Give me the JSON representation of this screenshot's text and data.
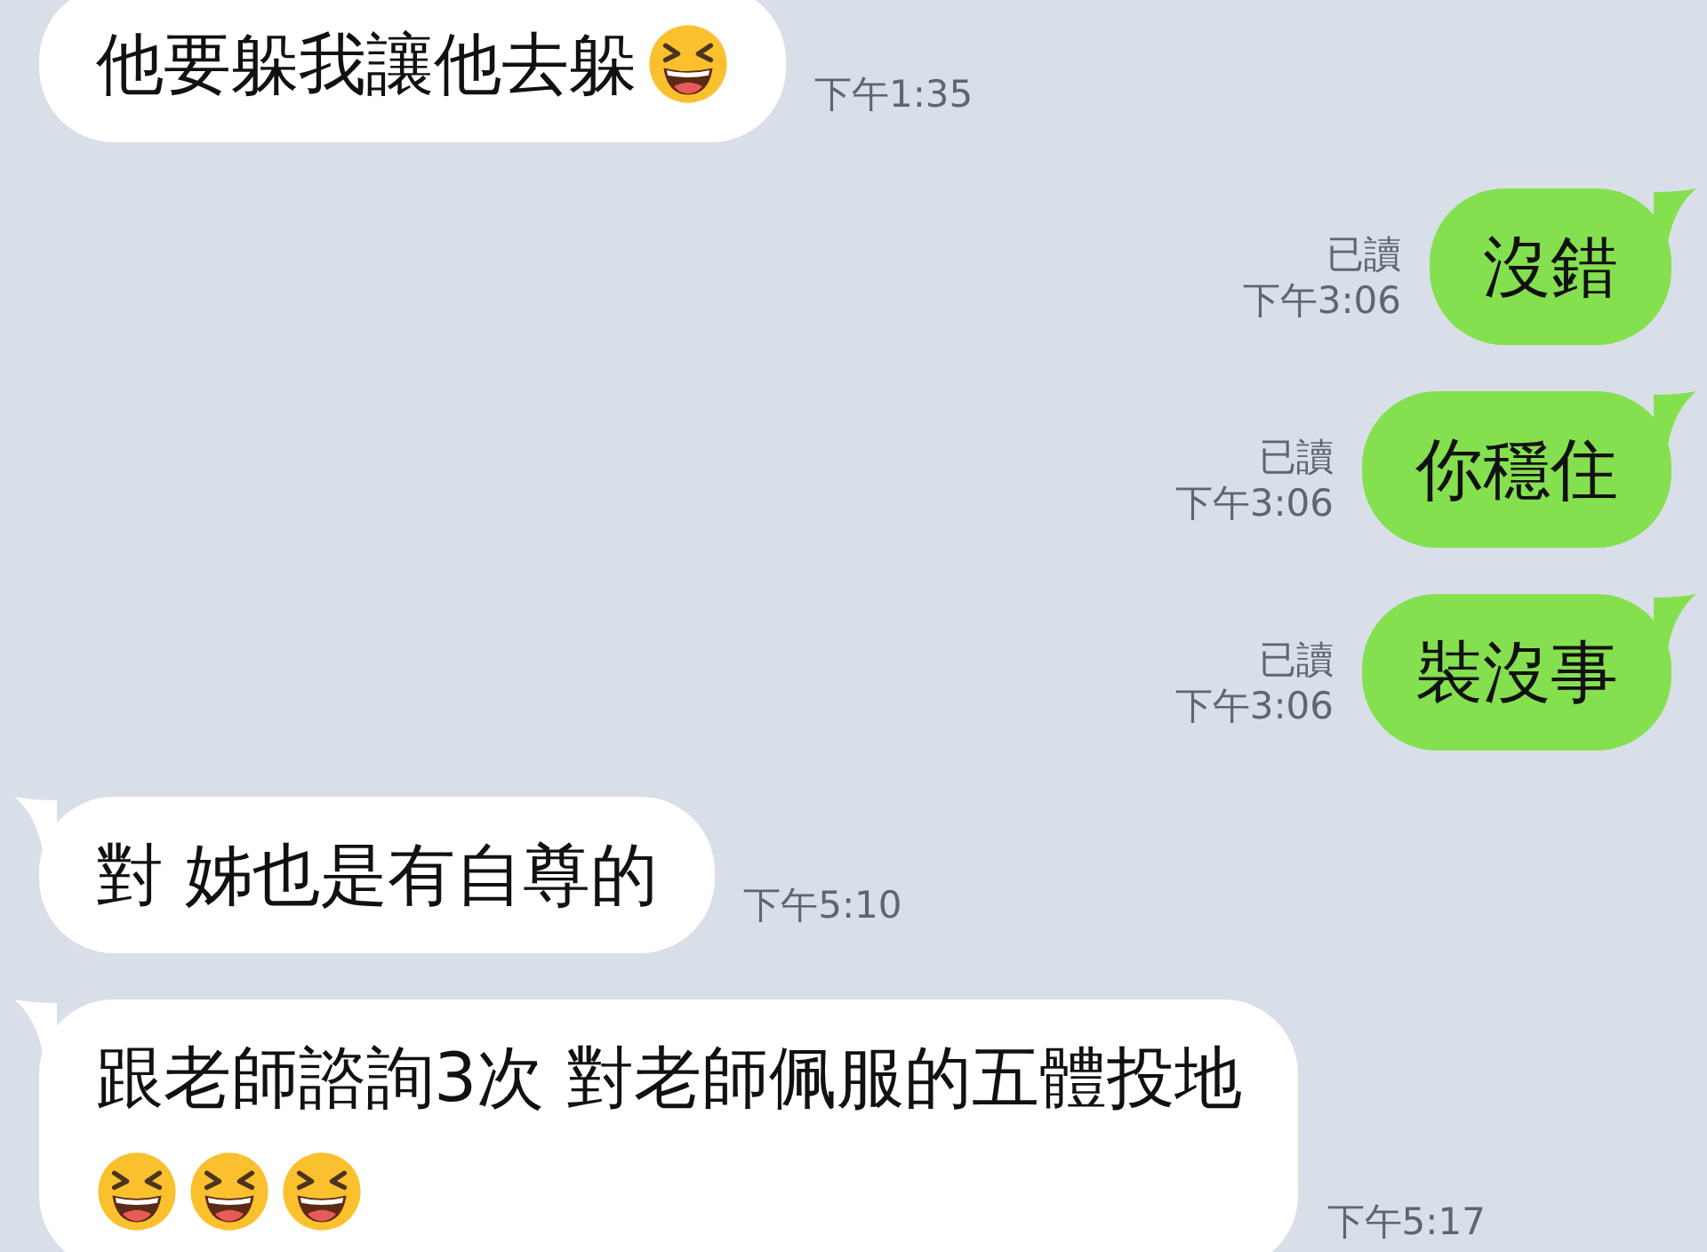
{
  "messages": [
    {
      "kind": "incoming",
      "lines": [
        {
          "text": "他要躲我讓他去躲",
          "emojis": [
            {
              "kind": "grinning-squint"
            }
          ]
        }
      ],
      "time": "下午1:35",
      "tail": false
    },
    {
      "kind": "outgoing",
      "lines": [
        {
          "text": "沒錯"
        }
      ],
      "read_label": "已讀",
      "time": "下午3:06",
      "tail": true
    },
    {
      "kind": "outgoing",
      "lines": [
        {
          "text": "你穩住"
        }
      ],
      "read_label": "已讀",
      "time": "下午3:06",
      "tail": true
    },
    {
      "kind": "outgoing",
      "lines": [
        {
          "text": "裝沒事"
        }
      ],
      "read_label": "已讀",
      "time": "下午3:06",
      "tail": true
    },
    {
      "kind": "incoming",
      "lines": [
        {
          "text": "對 姊也是有自尊的"
        }
      ],
      "time": "下午5:10",
      "tail": true
    },
    {
      "kind": "incoming",
      "lines": [
        {
          "text": "跟老師諮詢3次 對老師佩服的五體投地"
        },
        {
          "emojis": [
            {
              "kind": "grinning-squint"
            },
            {
              "kind": "grinning-squint"
            },
            {
              "kind": "grinning-squint"
            }
          ]
        }
      ],
      "time": "下午5:17",
      "tail": true
    }
  ]
}
